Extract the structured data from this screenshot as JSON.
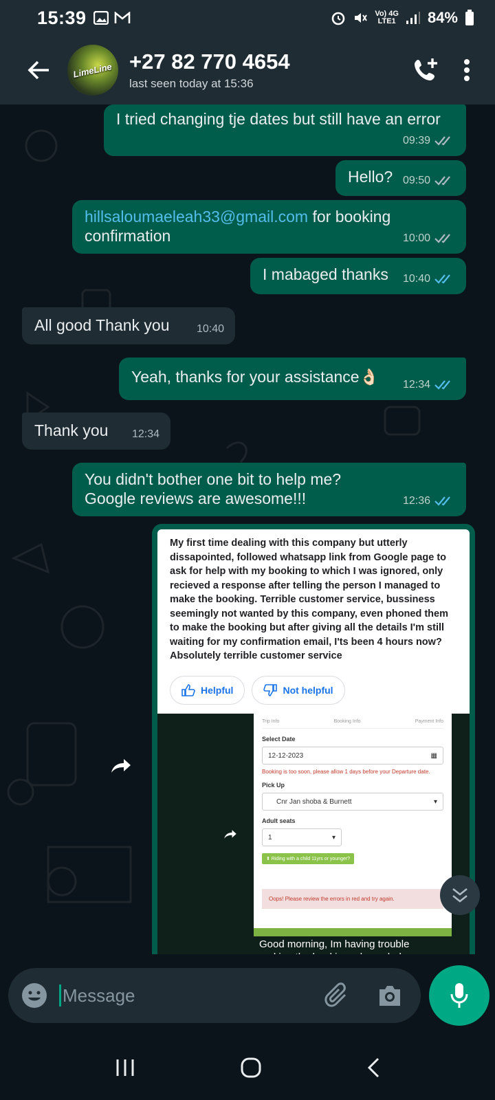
{
  "status_bar": {
    "time": "15:39",
    "network_top": "Vo) 4G",
    "network_bottom": "LTE1",
    "battery": "84%"
  },
  "header": {
    "contact_name": "+27 82 770 4654",
    "last_seen": "last seen today at 15:36",
    "avatar_text": "LimeLine"
  },
  "messages": [
    {
      "dir": "out",
      "text": "I tried changing tje dates but still have an error",
      "time": "09:39",
      "status": "delivered"
    },
    {
      "dir": "out",
      "text": "Hello?",
      "time": "09:50",
      "status": "delivered"
    },
    {
      "dir": "out",
      "link": "hillsaloumaeleah33@gmail.com",
      "text": " for booking confirmation",
      "time": "10:00",
      "status": "delivered"
    },
    {
      "dir": "out",
      "text": "I mabaged thanks",
      "time": "10:40",
      "status": "read"
    },
    {
      "dir": "in",
      "text": "All good Thank you",
      "time": "10:40"
    },
    {
      "dir": "out",
      "text": "Yeah, thanks for your assistance👌🏻",
      "time": "12:34",
      "status": "read"
    },
    {
      "dir": "in",
      "text": "Thank you",
      "time": "12:34"
    },
    {
      "dir": "out",
      "text": "You didn't bother one bit to help me? Google reviews are awesome!!!",
      "time": "12:36",
      "status": "read"
    }
  ],
  "image_message": {
    "review_text": "My first time dealing with this company but utterly dissapointed, followed whatsapp link from Google page to ask for help with my booking to which I was ignored, only recieved a response after telling the person I managed to make the booking. Terrible customer service, bussiness seemingly not wanted by this company, even phoned them to make the booking but after giving all the details I'm still waiting for my confirmation email, I'ts been 4 hours now? Absolutely terrible customer service",
    "helpful_label": "Helpful",
    "not_helpful_label": "Not helpful",
    "form": {
      "step1": "Trip Info",
      "step2": "Booking Info",
      "step3": "Payment Info",
      "select_date_label": "Select Date",
      "date_value": "12-12-2023",
      "date_error": "Booking is too soon, please allow 1 days before your Departure date.",
      "pickup_label": "Pick Up",
      "pickup_value": "Cnr Jan shoba & Burnett",
      "adult_label": "Adult seats",
      "adult_value": "1",
      "child_button": "⬆ Riding with a child 11yrs or younger?",
      "alert": "Oops! Please review the errors in red and try again."
    },
    "caption": "Good morning, Im having trouble making the booking, please help"
  },
  "input": {
    "placeholder": "Message"
  },
  "colors": {
    "outgoing": "#005c4b",
    "incoming": "#202c33",
    "accent": "#00a884",
    "read_tick": "#53bdeb"
  }
}
